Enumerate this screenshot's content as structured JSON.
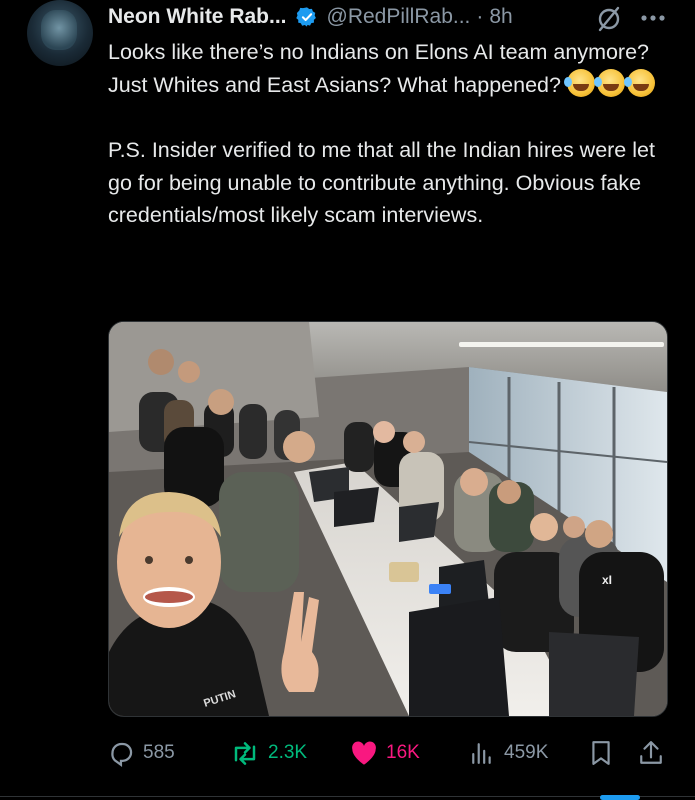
{
  "tweet": {
    "author_name": "Neon White Rab...",
    "handle": "@RedPillRab...",
    "separator": "·",
    "time": "8h",
    "paragraph1": "Looks like there’s no Indians on Elons AI team anymore? Just Whites and East Asians? What happened?",
    "paragraph2": "P.S. Insider verified to me that all the Indian hires were let go for being unable to contribute anything. Obvious fake credentials/most likely scam interviews.",
    "emojis": [
      "rolling-on-floor-laughing",
      "rolling-on-floor-laughing",
      "rolling-on-floor-laughing"
    ],
    "photo_text": {
      "shirt_print": "PUTIN",
      "shirt_logo": "xI"
    }
  },
  "actions": {
    "replies": "585",
    "retweets": "2.3K",
    "likes": "16K",
    "views": "459K"
  },
  "colors": {
    "background": "#000000",
    "text": "#e7e9ea",
    "muted": "#8b98a5",
    "verified": "#1d9bf0",
    "retweet": "#00ba7c",
    "like": "#f91880"
  }
}
